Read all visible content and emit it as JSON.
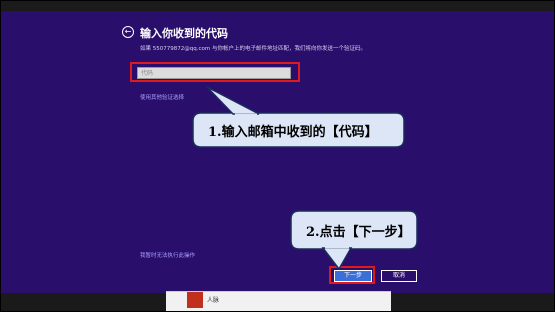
{
  "header": {
    "title": "输入你收到的代码",
    "description": "如果 550779872@qq.com 与你帐户上的电子邮件地址匹配，我们将向你发送一个验证码。"
  },
  "form": {
    "code_placeholder": "代码",
    "alt_method_link": "使用其他验证选择",
    "cant_do_link": "我暂时无法执行此操作"
  },
  "buttons": {
    "next": "下一步",
    "cancel": "取消"
  },
  "callouts": {
    "step1": "1.输入邮箱中收到的【代码】",
    "step2": "2.点击【下一步】"
  },
  "taskbar": {
    "people_label": "人脉"
  },
  "colors": {
    "background": "#2a0e6c",
    "highlight": "#e01a1a",
    "next_button": "#3b6fd8"
  }
}
